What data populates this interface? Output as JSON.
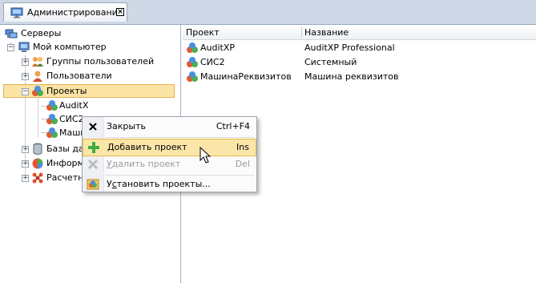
{
  "tab": {
    "title": "Администрирование",
    "close_glyph": "×",
    "icon": "monitor-icon"
  },
  "tree": {
    "root": {
      "label": "Серверы",
      "icon": "servers-icon"
    },
    "computer": {
      "label": "Мой компьютер",
      "icon": "computer-icon",
      "expander": "−"
    },
    "user_groups": {
      "label": "Группы пользователей",
      "icon": "user-group-icon",
      "expander": "+"
    },
    "users": {
      "label": "Пользователи",
      "icon": "user-icon",
      "expander": "+"
    },
    "projects": {
      "label": "Проекты",
      "icon": "projects-icon",
      "expander": "−"
    },
    "projects_children": [
      {
        "label": "AuditX"
      },
      {
        "label": "СИС2"
      },
      {
        "label": "Маши"
      }
    ],
    "databases": {
      "label": "Базы дан",
      "icon": "database-icon",
      "expander": "+"
    },
    "info": {
      "label": "Информ",
      "icon": "info-icon",
      "expander": "+"
    },
    "calc_bases": {
      "label": "Расчетные базы",
      "icon": "calc-bases-icon",
      "expander": "+"
    }
  },
  "list": {
    "columns": [
      "Проект",
      "Название"
    ],
    "rows": [
      {
        "project": "AuditXP",
        "name": "AuditXP Professional"
      },
      {
        "project": "СИС2",
        "name": "Системный"
      },
      {
        "project": "МашинаРеквизитов",
        "name": "Машина реквизитов"
      }
    ]
  },
  "context_menu": {
    "close": {
      "label": "Закрыть",
      "shortcut": "Ctrl+F4",
      "icon": "close-icon"
    },
    "add": {
      "label_first": "Д",
      "label_rest": "обавить проект",
      "shortcut": "Ins",
      "icon": "add-icon"
    },
    "remove": {
      "label_first": "У",
      "label_rest": "далить проект",
      "shortcut": "Del",
      "icon": "remove-icon"
    },
    "install": {
      "label_pre": "У",
      "label_u": "с",
      "label_rest": "тановить проекты...",
      "icon": "install-icon"
    }
  },
  "colors": {
    "selection": "#fbe4a6",
    "menu_highlight": "#fbe6a9",
    "disabled_text": "#9b9b9b"
  }
}
